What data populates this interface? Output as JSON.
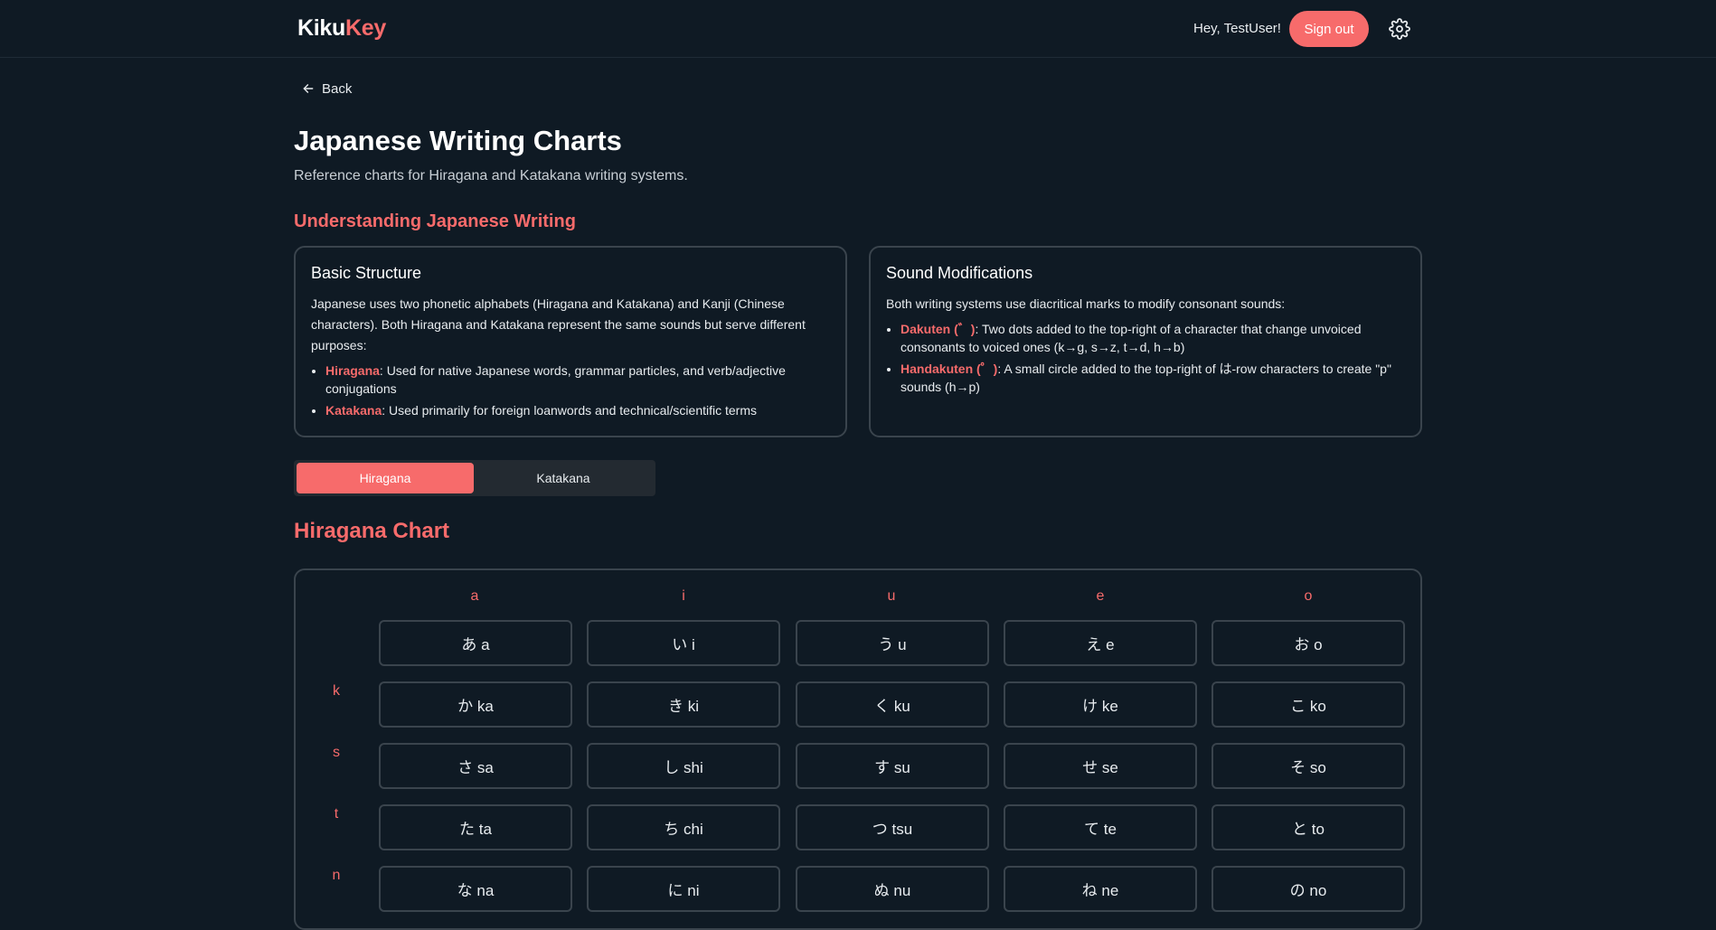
{
  "header": {
    "logo_part1": "Kiku",
    "logo_part2": "Key",
    "greeting": "Hey, TestUser!",
    "signout_label": "Sign out",
    "settings_icon": "gear-icon"
  },
  "nav": {
    "back_label": "Back",
    "back_icon": "arrow-left-icon"
  },
  "page": {
    "title": "Japanese Writing Charts",
    "subtitle": "Reference charts for Hiragana and Katakana writing systems.",
    "section_title": "Understanding Japanese Writing"
  },
  "cards": {
    "basic": {
      "title": "Basic Structure",
      "body": "Japanese uses two phonetic alphabets (Hiragana and Katakana) and Kanji (Chinese characters). Both Hiragana and Katakana represent the same sounds but serve different purposes:",
      "items": [
        {
          "term": "Hiragana",
          "text": ": Used for native Japanese words, grammar particles, and verb/adjective conjugations"
        },
        {
          "term": "Katakana",
          "text": ": Used primarily for foreign loanwords and technical/scientific terms"
        }
      ]
    },
    "sound": {
      "title": "Sound Modifications",
      "body": "Both writing systems use diacritical marks to modify consonant sounds:",
      "items": [
        {
          "term": "Dakuten (゛)",
          "text": ": Two dots added to the top-right of a character that change unvoiced consonants to voiced ones (k→g, s→z, t→d, h→b)"
        },
        {
          "term": "Handakuten (゜)",
          "text": ": A small circle added to the top-right of は-row characters to create \"p\" sounds (h→p)"
        }
      ]
    }
  },
  "tabs": {
    "hiragana": "Hiragana",
    "katakana": "Katakana",
    "active": "Hiragana"
  },
  "chart": {
    "title": "Hiragana Chart",
    "columns": [
      "a",
      "i",
      "u",
      "e",
      "o"
    ],
    "rows": [
      {
        "label": "",
        "cells": [
          "あ a",
          "い i",
          "う u",
          "え e",
          "お o"
        ]
      },
      {
        "label": "k",
        "cells": [
          "か ka",
          "き ki",
          "く ku",
          "け ke",
          "こ ko"
        ]
      },
      {
        "label": "s",
        "cells": [
          "さ sa",
          "し shi",
          "す su",
          "せ se",
          "そ so"
        ]
      },
      {
        "label": "t",
        "cells": [
          "た ta",
          "ち chi",
          "つ tsu",
          "て te",
          "と to"
        ]
      },
      {
        "label": "n",
        "cells": [
          "な na",
          "に ni",
          "ぬ nu",
          "ね ne",
          "の no"
        ]
      }
    ]
  },
  "colors": {
    "accent": "#f76b6b",
    "background": "#0f1a24",
    "border": "#3a444d"
  }
}
